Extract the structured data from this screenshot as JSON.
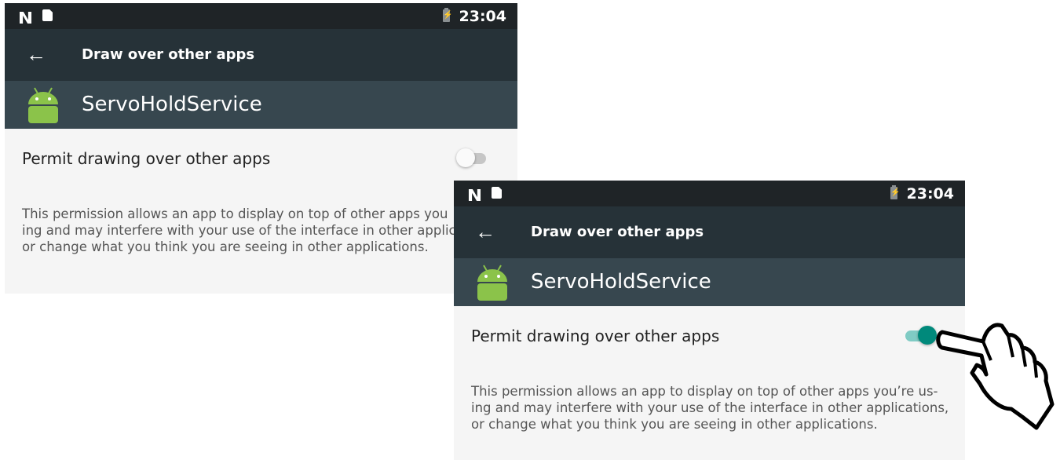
{
  "screens": [
    {
      "statusbar": {
        "time": "23:04"
      },
      "toolbar": {
        "back_icon": "arrow-left-icon",
        "title": "Draw over other apps"
      },
      "app": {
        "name": "ServoHoldService",
        "icon": "android-robot-icon"
      },
      "setting": {
        "label": "Permit drawing over other apps",
        "enabled": false
      },
      "description": [
        "This permission allows an app to display on top of other apps you",
        "ing and may interfere with your use of the interface in other applic",
        "or change what you think you are seeing in other applications."
      ]
    },
    {
      "statusbar": {
        "time": "23:04"
      },
      "toolbar": {
        "back_icon": "arrow-left-icon",
        "title": "Draw over other apps"
      },
      "app": {
        "name": "ServoHoldService",
        "icon": "android-robot-icon"
      },
      "setting": {
        "label": "Permit drawing over other apps",
        "enabled": true
      },
      "description": "This permission allows an app to display on top of other apps you’re us-ing and may interfere with your use of the interface in other applications, or change what you think you are seeing in other applications."
    }
  ],
  "colors": {
    "statusbar": "#1f2427",
    "toolbar": "#263238",
    "app_header": "#37474f",
    "android_green": "#8bc34a",
    "switch_on": "#00897b"
  },
  "annotation": {
    "icon": "pointing-hand-icon"
  }
}
